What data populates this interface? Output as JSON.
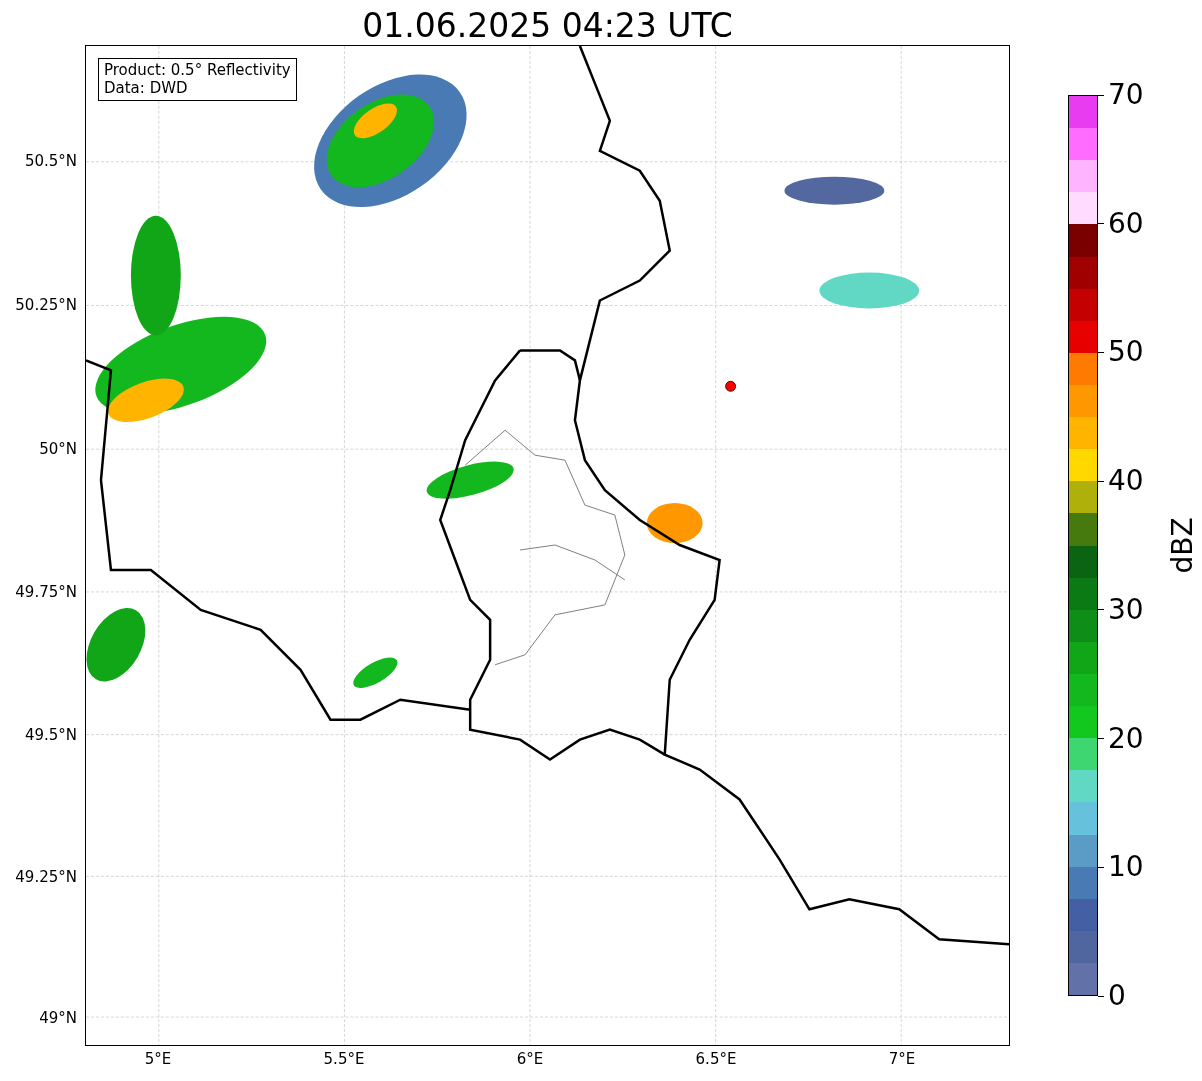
{
  "title": "01.06.2025 04:23 UTC",
  "info_box": {
    "lines": [
      "Product: 0.5° Reflectivity",
      "Data: DWD"
    ]
  },
  "x_ticks": [
    "5°E",
    "5.5°E",
    "6°E",
    "6.5°E",
    "7°E"
  ],
  "y_ticks": [
    "50.5°N",
    "50.25°N",
    "50°N",
    "49.75°N",
    "49.5°N",
    "49.25°N",
    "49°N"
  ],
  "colorbar": {
    "label": "dBZ",
    "ticks": [
      "70",
      "60",
      "50",
      "40",
      "30",
      "20",
      "10",
      "0"
    ],
    "segments": [
      {
        "color": "#e83cf0"
      },
      {
        "color": "#ff6cff"
      },
      {
        "color": "#ffb4ff"
      },
      {
        "color": "#ffdcff"
      },
      {
        "color": "#7a0000"
      },
      {
        "color": "#a00000"
      },
      {
        "color": "#c40000"
      },
      {
        "color": "#e60000"
      },
      {
        "color": "#ff7a00"
      },
      {
        "color": "#ff9800"
      },
      {
        "color": "#ffb400"
      },
      {
        "color": "#ffd800"
      },
      {
        "color": "#b0b00a"
      },
      {
        "color": "#467a0e"
      },
      {
        "color": "#0a6412"
      },
      {
        "color": "#0c7a14"
      },
      {
        "color": "#0e8e18"
      },
      {
        "color": "#10a618"
      },
      {
        "color": "#12b81e"
      },
      {
        "color": "#12c81e"
      },
      {
        "color": "#3ed670"
      },
      {
        "color": "#60d8c4"
      },
      {
        "color": "#66c2dc"
      },
      {
        "color": "#5a9cc6"
      },
      {
        "color": "#4a7ab4"
      },
      {
        "color": "#4460a4"
      },
      {
        "color": "#50669e"
      },
      {
        "color": "#6272a8"
      }
    ]
  }
}
